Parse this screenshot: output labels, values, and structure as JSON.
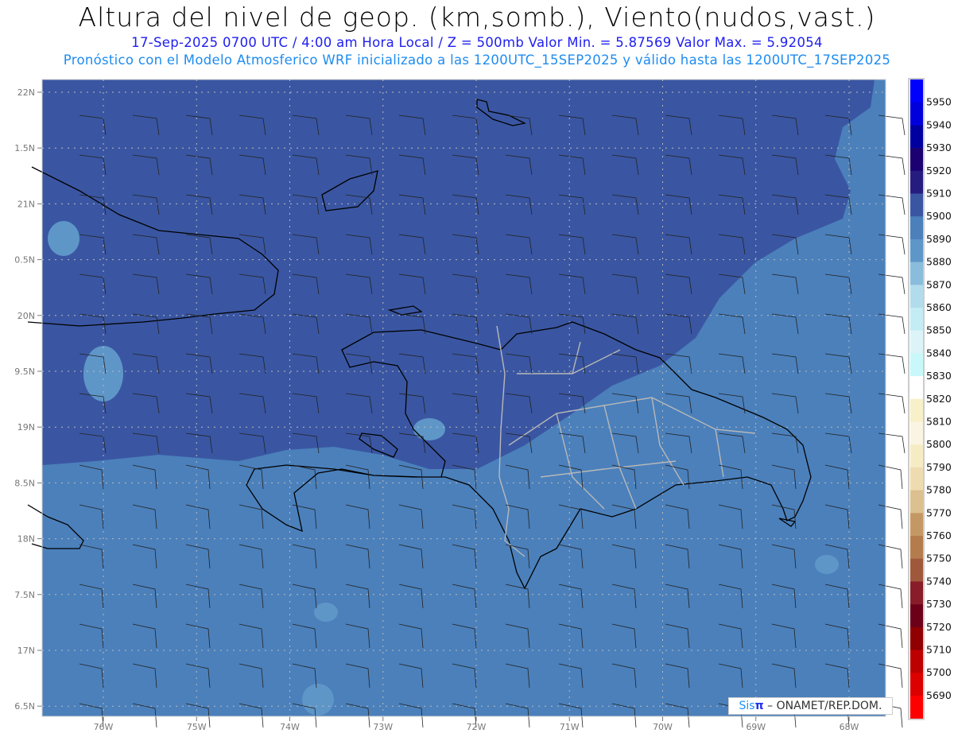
{
  "header": {
    "title": "Altura del nivel de geop. (km,somb.), Viento(nudos,vast.)",
    "subtitle": "17-Sep-2025  0700 UTC / 4:00 am Hora Local / Z = 500mb    Valor Min. = 5.87569  Valor Max. = 5.92054",
    "forecast_line": "Pronóstico con el Modelo Atmosferico WRF inicializado a las 1200UTC_15SEP2025 y válido hasta las  1200UTC_17SEP2025"
  },
  "map": {
    "lat_labels": [
      "22N",
      "1.5N",
      "21N",
      "0.5N",
      "20N",
      "9.5N",
      "19N",
      "8.5N",
      "18N",
      "7.5N",
      "17N",
      "6.5N"
    ],
    "lon_labels": [
      "76W",
      "75W",
      "74W",
      "73W",
      "72W",
      "71W",
      "70W",
      "69W",
      "68W"
    ],
    "colors": {
      "shade_5900": "#3a56a2",
      "shade_5890": "#4b80bb",
      "shade_5880": "#5f96c8",
      "coast": "#000000",
      "borders": "#b8b8b8"
    }
  },
  "colorbar": {
    "labels": [
      "5950",
      "5940",
      "5930",
      "5920",
      "5910",
      "5900",
      "5890",
      "5880",
      "5870",
      "5860",
      "5850",
      "5840",
      "5830",
      "5820",
      "5810",
      "5800",
      "5790",
      "5780",
      "5770",
      "5760",
      "5750",
      "5740",
      "5730",
      "5720",
      "5710",
      "5700",
      "5690"
    ],
    "colors": [
      "#0000ff",
      "#0000dd",
      "#0000a0",
      "#1a0070",
      "#261c80",
      "#3a56a2",
      "#4b80bb",
      "#5f96c8",
      "#8abcdc",
      "#b0dcec",
      "#c4ecf4",
      "#dcf4f8",
      "#c8f8fa",
      "#ffffff",
      "#f8f0c8",
      "#faf4e2",
      "#f6ecc4",
      "#eedcb0",
      "#dcc090",
      "#c49864",
      "#b47c4c",
      "#a0583c",
      "#881c28",
      "#6c0018",
      "#900000",
      "#bc0000",
      "#dc0000",
      "#ff0000"
    ]
  },
  "credit": {
    "brand_a": "Sis",
    "brand_b": "π",
    "text": " –  ONAMET/REP.DOM."
  }
}
